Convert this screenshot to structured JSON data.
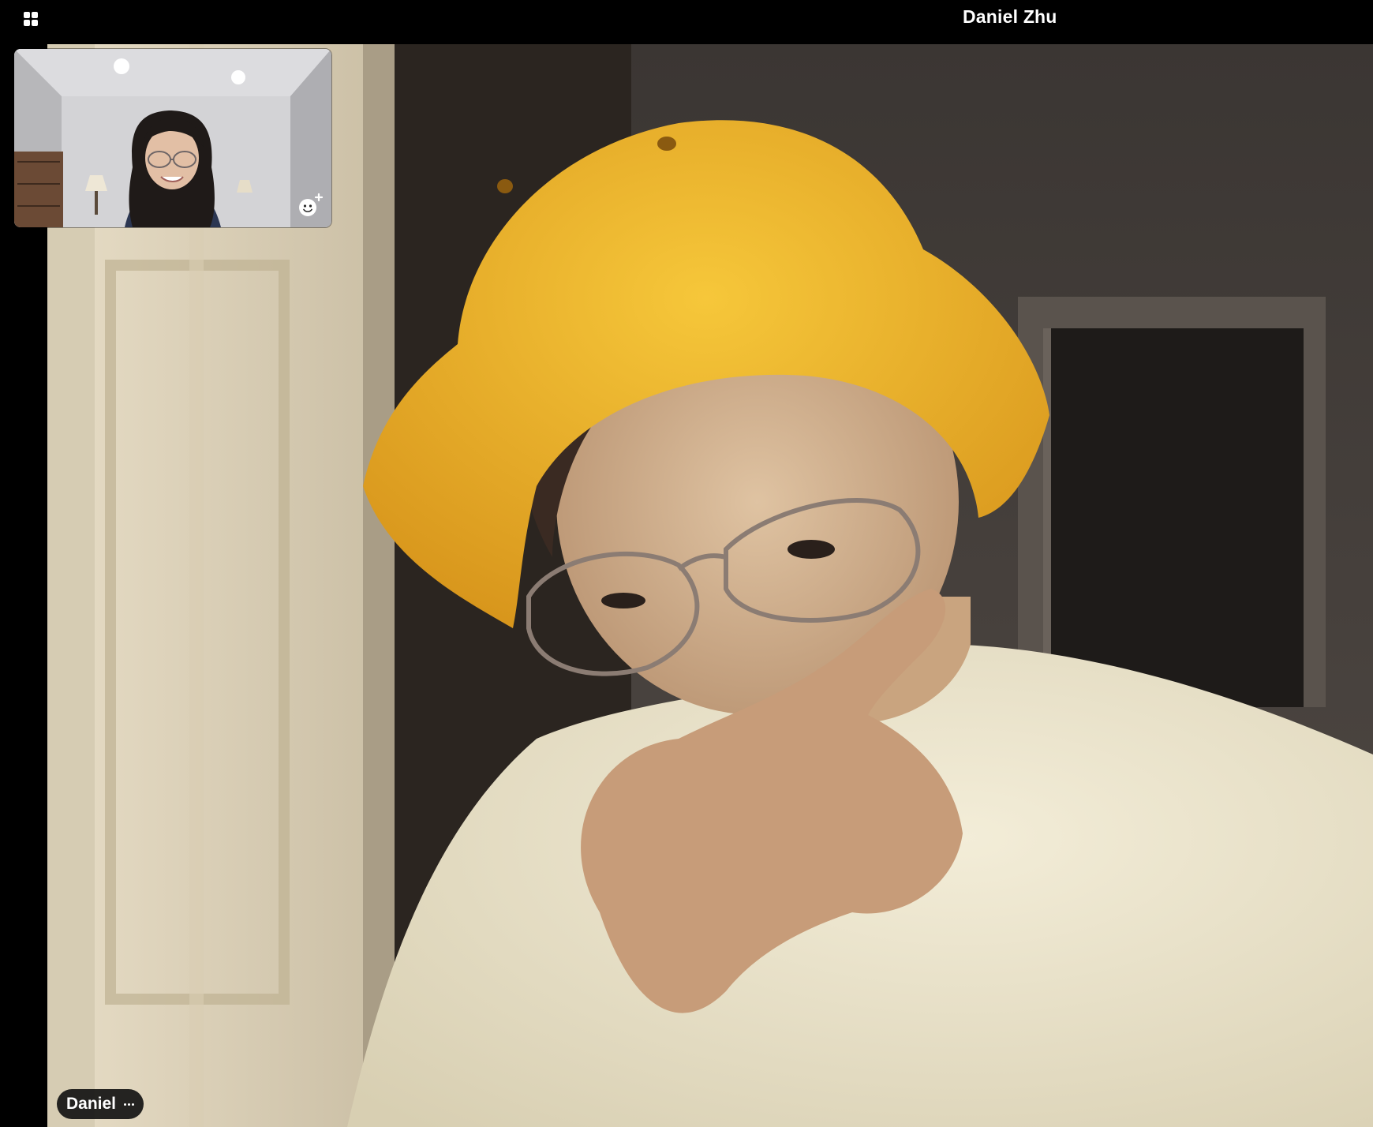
{
  "header": {
    "meeting_title": "Daniel Zhu",
    "layout_icon": "grid-icon"
  },
  "main_video": {
    "participant_label": "Daniel",
    "more_icon": "more-options-icon"
  },
  "self_view": {
    "reaction_icon": "add-reaction-icon"
  },
  "colors": {
    "background": "#000000",
    "hat": "#e8b22a",
    "name_tag": "#0f0f0f"
  }
}
